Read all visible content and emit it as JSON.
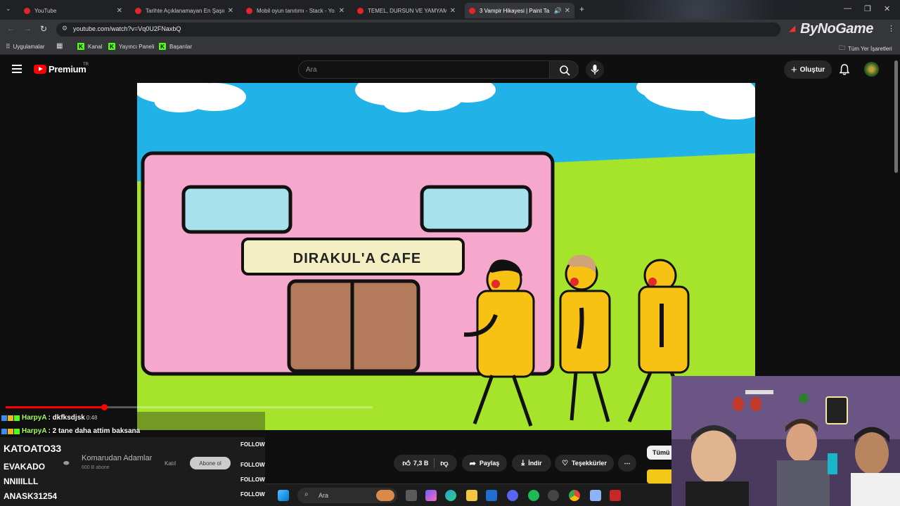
{
  "browser": {
    "tabs": [
      {
        "title": "YouTube",
        "active": false
      },
      {
        "title": "Tarihte Açıklanamayan En Şaşırt",
        "active": false
      },
      {
        "title": "Mobil oyun tanıtımı - Stack - Yo",
        "active": false
      },
      {
        "title": "TEMEL, DURSUN VE YAMYAML",
        "active": false
      },
      {
        "title": "3 Vampir Hikayesi | Paint Ta",
        "active": true
      }
    ],
    "url": "youtube.com/watch?v=Vq0U2FNaxbQ",
    "overlay_brand": "ByNoGame",
    "bookmarks": [
      "Uygulamalar",
      "Kanal",
      "Yayıncı Paneli",
      "Başarılar"
    ],
    "bookmarks_folder": "Tüm Yer İşaretleri"
  },
  "youtube": {
    "logo_text": "Premium",
    "region": "TR",
    "search_placeholder": "Ara",
    "create_label": "Oluştur",
    "video": {
      "sign_text": "DIRAKUL'A CAFE",
      "progress": 0.27
    },
    "channel": {
      "name": "Komarudan Adamlar",
      "subs": "600 B abone",
      "join_label": "Katıl",
      "subscribe_label": "Abone ol"
    },
    "actions": {
      "likes": "7,3 B",
      "share": "Paylaş",
      "download": "İndir",
      "thanks": "Teşekkürler",
      "filter_all": "Tümü"
    }
  },
  "stream_overlay": {
    "chat": [
      {
        "user": "HarpyA",
        "message": ": dkfksdjsk",
        "time_fragment": "0:48"
      },
      {
        "user": "HarpyA",
        "message": ": 2 tane daha attim baksana"
      }
    ],
    "followers": [
      {
        "name": "KATOATO33",
        "action": "FOLLOW"
      },
      {
        "name": "EVAKADO",
        "action": "FOLLOW"
      },
      {
        "name": "NNIIILLL",
        "action": "FOLLOW"
      },
      {
        "name": "ANASK31254",
        "action": "FOLLOW"
      }
    ]
  },
  "taskbar": {
    "search_placeholder": "Ara"
  },
  "colors": {
    "youtube_red": "#ff0000",
    "chat_user": "#a6ff5c",
    "kick_green": "#53fc18",
    "sky": "#21b3e8",
    "grass": "#a6e42b",
    "cafe_pink": "#f5a8cb"
  }
}
